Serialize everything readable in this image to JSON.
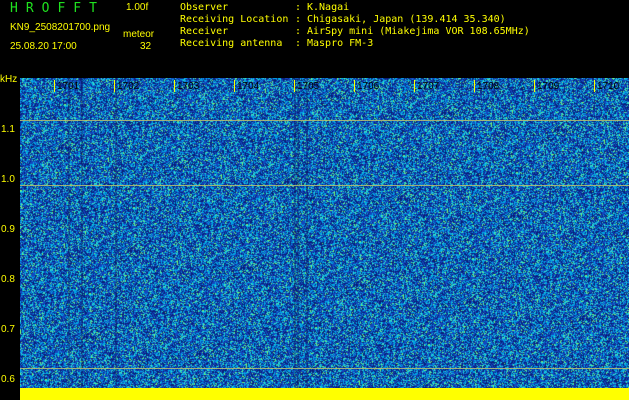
{
  "header": {
    "app_title": "HROFFT",
    "version": "1.00f",
    "filename": "KN9_2508201700.png",
    "meteor_label": "meteor",
    "datetime": "25.08.20 17:00",
    "meteor_count": "32"
  },
  "info": [
    {
      "label": "Observer",
      "value": "K.Nagai"
    },
    {
      "label": "Receiving Location",
      "value": "Chigasaki, Japan (139.414 35.340)"
    },
    {
      "label": "Receiver",
      "value": "AirSpy mini (Miakejima VOR 108.65MHz)"
    },
    {
      "label": "Receiving antenna",
      "value": "Maspro FM-3"
    }
  ],
  "spectrogram": {
    "y_unit": "kHz",
    "y_ticks": [
      "1.1",
      "1.0",
      "0.9",
      "0.8",
      "0.7",
      "0.6"
    ],
    "time_ticks": [
      "1701",
      "1702",
      "1703",
      "1704",
      "1705",
      "1706",
      "1707",
      "1708",
      "1709",
      "1710"
    ]
  },
  "colors": {
    "background": "#000000",
    "text": "#ffff00",
    "title": "#1fe21f",
    "spectrogram_base": "#103a9a",
    "noise_cyan": "#00e0ff",
    "noise_green": "#40ff80"
  }
}
